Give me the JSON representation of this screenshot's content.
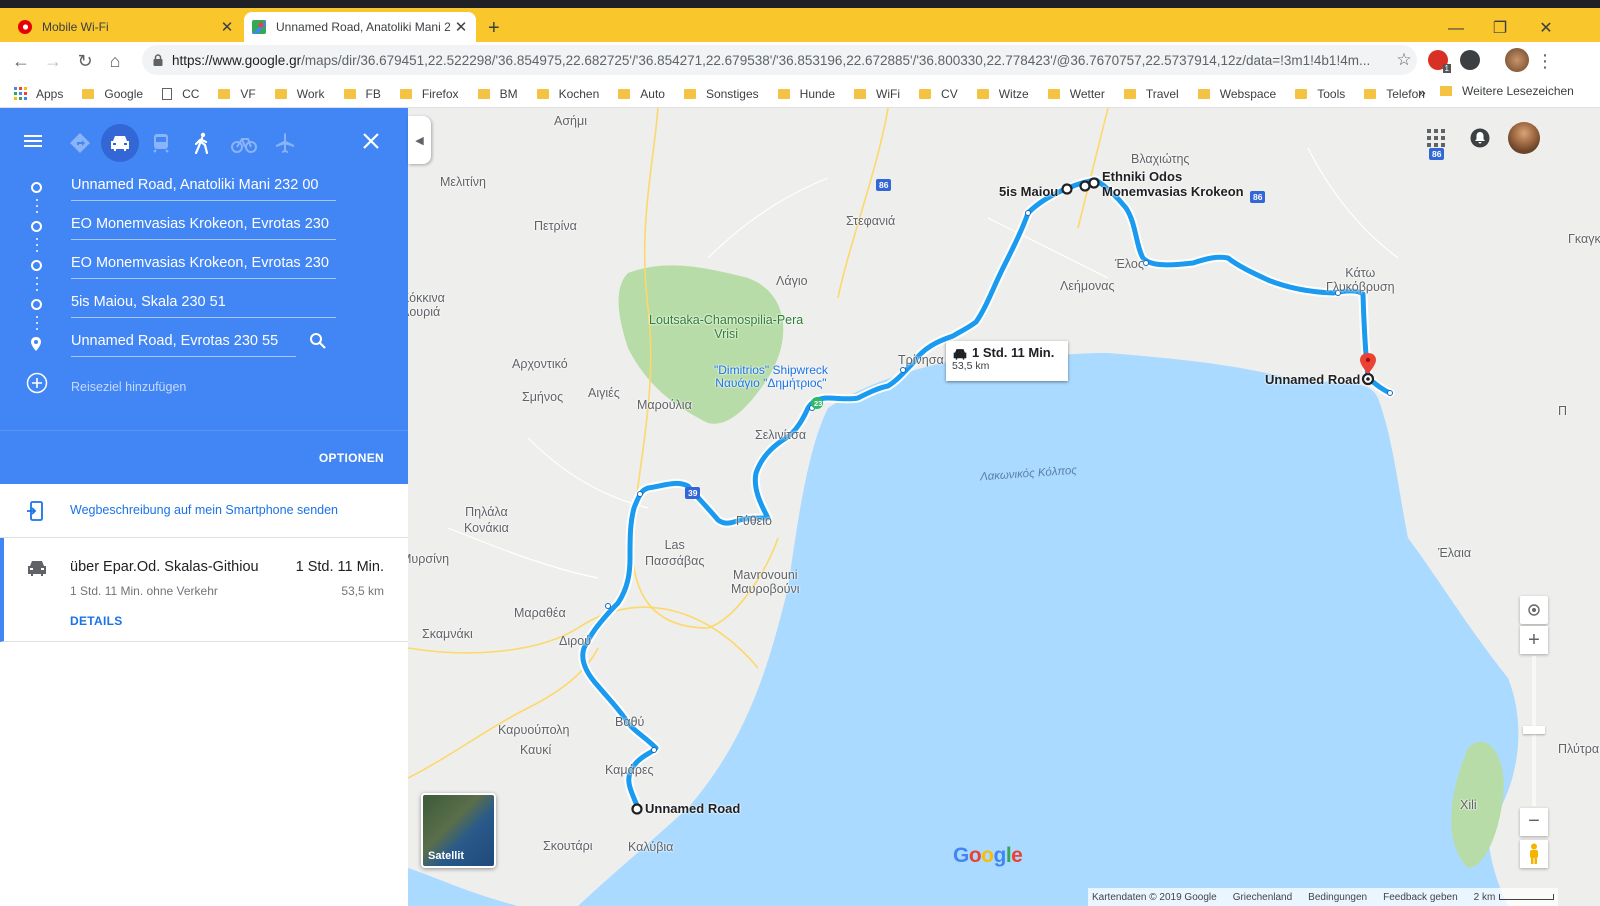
{
  "browser": {
    "tabs": [
      {
        "title": "Mobile Wi-Fi",
        "active": false
      },
      {
        "title": "Unnamed Road, Anatoliki Mani 2",
        "active": true
      }
    ],
    "url_host": "https://www.google.gr",
    "url_path": "/maps/dir/36.679451,22.522298/'36.854975,22.682725'/'36.854271,22.679538'/'36.853196,22.672885'/'36.800330,22.778423'/@36.7670757,22.5737914,12z/data=!3m1!4b1!4m...",
    "bookmarks": [
      "Apps",
      "Google",
      "CC",
      "VF",
      "Work",
      "FB",
      "Firefox",
      "BM",
      "Kochen",
      "Auto",
      "Sonstiges",
      "Hunde",
      "WiFi",
      "CV",
      "Witze",
      "Wetter",
      "Travel",
      "Webspace",
      "Tools",
      "Telefon"
    ],
    "bookmarks_more": "»",
    "other_bookmarks": "Weitere Lesezeichen",
    "ext_badge": "1"
  },
  "directions": {
    "waypoints": [
      "Unnamed Road, Anatoliki Mani 232 00",
      "EO Monemvasias Krokeon, Evrotas 230",
      "EO Monemvasias Krokeon, Evrotas 230",
      "5is Maiou, Skala 230 51",
      "Unnamed Road, Evrotas 230 55"
    ],
    "add_destination": "Reiseziel hinzufügen",
    "options": "OPTIONEN",
    "send_to_phone": "Wegbeschreibung auf mein Smartphone senden",
    "route": {
      "via": "über Epar.Od. Skalas-Githiou",
      "time": "1 Std. 11 Min.",
      "sub": "1 Std. 11 Min. ohne Verkehr",
      "distance": "53,5 km",
      "details": "DETAILS"
    }
  },
  "map": {
    "route_box_time": "1 Std. 11 Min.",
    "route_box_distance": "53,5 km",
    "satellite_label": "Satellit",
    "logo": "Google",
    "footer": [
      "Kartendaten © 2019 Google",
      "Griechenland",
      "Bedingungen",
      "Feedback geben"
    ],
    "scale": "2 km",
    "labels": {
      "asimi": "Ασήμι",
      "melitini": "Μελιτίνη",
      "petrina": "Πετρίνα",
      "stefania": "Στεφανιά",
      "vlachiotis": "Βλαχιώτης",
      "gkagk": "Γκαγκ",
      "kokkina": "Κόκκινα\nΛουριά",
      "lagio": "Λάγιο",
      "leimonas": "Λεήμονας",
      "elos": "Έλος",
      "kato": "Κάτω\nΓλυκόβρυση",
      "loutsaka": "Loutsaka-Chamospilia-Pera\nVrisi",
      "shipwreck": "\"Dimitrios\" Shipwreck\nΝαυάγιο \"Δημήτριος\"",
      "trinisa": "Τρίνησα",
      "archontiko": "Αρχοντικό",
      "simos": "Σμήνος",
      "agies": "Αιγιές",
      "maroulia": "Μαρούλια",
      "selinitsa": "Σελινίτσα",
      "sea": "Λακωνικός Κόλπος",
      "p": "Π",
      "pilala": "Πηλάλα\nΚονάκια",
      "gytheio": "Γύθειο",
      "las": "Las\nΠασσάβας",
      "myrsini": "Μυρσίνη",
      "mavrovouni": "Mavrovouni\nΜαυροβούνι",
      "marathea": "Μαραθέα",
      "elaia": "Έλαια",
      "skamnaki": "Σκαμνάκι",
      "dirou": "Διρού",
      "vathy": "Βαθύ",
      "karyoupoli": "Καρυούπολη",
      "kavki": "Καυκί",
      "kamares": "Καμάρες",
      "skoutari": "Σκουτάρι",
      "kalyvia": "Καλύβια",
      "plytra": "Πλύτρα",
      "xili": "Xili",
      "five_maiou": "5is Maiou",
      "ethniki": "Ethniki Odos\nMonemvasias Krokeon",
      "unnamed_east": "Unnamed Road",
      "unnamed_south": "Unnamed Road",
      "r86a": "86",
      "r86b": "86",
      "r86c": "86",
      "r39": "39",
      "r23": "23"
    }
  },
  "colors": {
    "tabstrip": "#f9c62b",
    "panel": "#4285f4",
    "route": "#1a9bf0",
    "sea": "#aadaff",
    "land": "#eeeeec",
    "park": "#b8dca8"
  }
}
